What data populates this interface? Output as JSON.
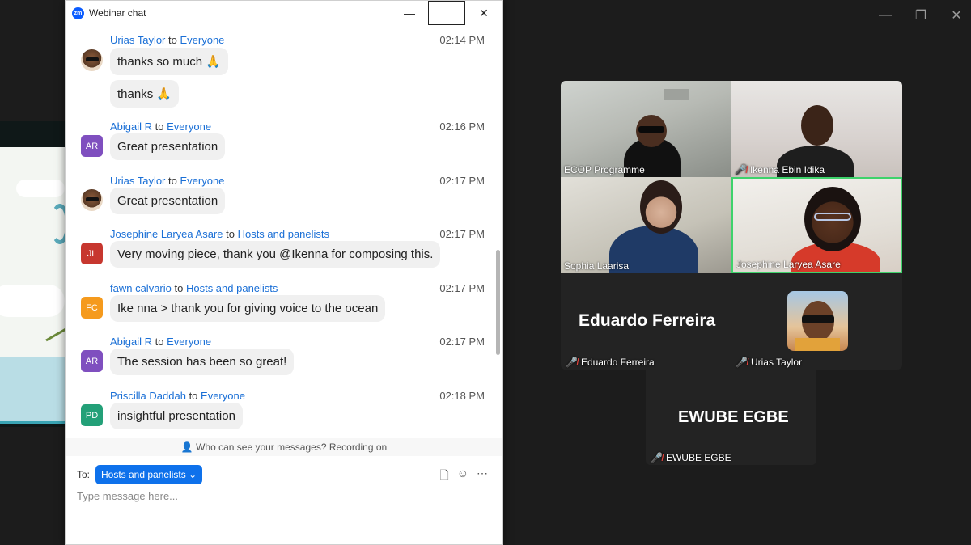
{
  "window_controls": {
    "minimize": "—",
    "restore": "❐",
    "close": "✕"
  },
  "chat": {
    "title": "Webinar chat",
    "logo_text": "zm",
    "controls": {
      "minimize": "—",
      "close": "✕"
    },
    "messages": [
      {
        "sender": "Urias Taylor",
        "to_word": "to",
        "recipient": "Everyone",
        "time": "02:14 PM",
        "avatar_type": "photo",
        "texts": [
          "thanks so much 🙏",
          "thanks 🙏"
        ]
      },
      {
        "sender": "Abigail R",
        "to_word": "to",
        "recipient": "Everyone",
        "time": "02:16 PM",
        "avatar": "AR",
        "avatar_color": "#7f4fbf",
        "texts": [
          "Great presentation"
        ]
      },
      {
        "sender": "Urias Taylor",
        "to_word": "to",
        "recipient": "Everyone",
        "time": "02:17 PM",
        "avatar_type": "photo",
        "texts": [
          "Great presentation"
        ]
      },
      {
        "sender": "Josephine Laryea Asare",
        "to_word": "to",
        "recipient": "Hosts and panelists",
        "time": "02:17 PM",
        "avatar": "JL",
        "avatar_color": "#c7372f",
        "texts": [
          "Very moving piece, thank you @Ikenna for composing this."
        ]
      },
      {
        "sender": "fawn calvario",
        "to_word": "to",
        "recipient": "Hosts and panelists",
        "time": "02:17 PM",
        "avatar": "FC",
        "avatar_color": "#f59a1d",
        "texts": [
          "Ike nna > thank you for giving voice to the ocean"
        ]
      },
      {
        "sender": "Abigail R",
        "to_word": "to",
        "recipient": "Everyone",
        "time": "02:17 PM",
        "avatar": "AR",
        "avatar_color": "#7f4fbf",
        "texts": [
          "The session has been so great!"
        ]
      },
      {
        "sender": "Priscilla Daddah",
        "to_word": "to",
        "recipient": "Everyone",
        "time": "02:18 PM",
        "avatar": "PD",
        "avatar_color": "#23a078",
        "texts": [
          "insightful presentation"
        ]
      }
    ],
    "notice": "Who can see your messages? Recording on",
    "compose": {
      "to_label": "To:",
      "to_value": "Hosts and panelists",
      "placeholder": "Type message here..."
    }
  },
  "gallery": {
    "participants": [
      {
        "name": "ECOP Programme",
        "muted": false
      },
      {
        "name": "Ikenna Ebin Idika",
        "muted": true
      },
      {
        "name": "Sophia Laarisa",
        "muted": false
      },
      {
        "name": "Josephine Laryea Asare",
        "muted": false,
        "active_speaker": true
      },
      {
        "name": "Eduardo Ferreira",
        "muted": true,
        "video_off": true,
        "display": "Eduardo Ferreira"
      },
      {
        "name": "Urias Taylor",
        "muted": true
      },
      {
        "name": "EWUBE EGBE",
        "muted": true,
        "video_off": true,
        "display": "EWUBE EGBE"
      }
    ],
    "mic_off_icon": "mic-off",
    "accent_color": "#3ed26b"
  }
}
